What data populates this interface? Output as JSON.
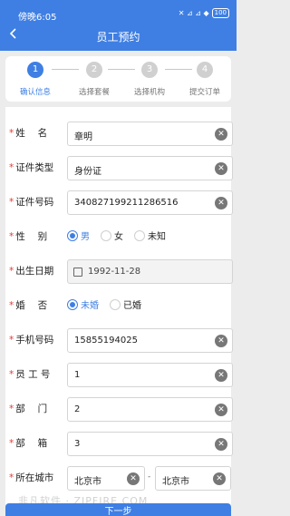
{
  "status": {
    "time": "傍晚6:05",
    "icons": "✕ ⊿ ⊿ ◆",
    "battery": "100"
  },
  "header": {
    "title": "员工预约"
  },
  "steps": [
    {
      "num": "1",
      "label": "确认信息"
    },
    {
      "num": "2",
      "label": "选择套餐"
    },
    {
      "num": "3",
      "label": "选择机构"
    },
    {
      "num": "4",
      "label": "提交订单"
    }
  ],
  "form": {
    "required_mark": "*",
    "name": {
      "label": "姓　 名",
      "value": "章明"
    },
    "id_type": {
      "label": "证件类型",
      "value": "身份证"
    },
    "id_number": {
      "label": "证件号码",
      "value": "340827199211286516"
    },
    "gender": {
      "label": "性　 别",
      "options": [
        "男",
        "女",
        "未知"
      ],
      "selected": "男"
    },
    "birthday": {
      "label": "出生日期",
      "value": "1992-11-28"
    },
    "married": {
      "label": "婚　 否",
      "options": [
        "未婚",
        "已婚"
      ],
      "selected": "未婚"
    },
    "phone": {
      "label": "手机号码",
      "value": "15855194025"
    },
    "employee_no": {
      "label": "员 工 号",
      "value": "1"
    },
    "department": {
      "label": "部　 门",
      "value": "2"
    },
    "dept_box": {
      "label": "部　 箱",
      "value": "3"
    },
    "city": {
      "label": "所在城市",
      "value_left": "北京市",
      "separator": "-",
      "value_right": "北京市"
    }
  },
  "footer": {
    "next_label": "下一步"
  },
  "watermark": "非凡软件 · ZIPFIRE.COM",
  "colors": {
    "primary": "#3f7fe3",
    "required": "#e53935"
  }
}
